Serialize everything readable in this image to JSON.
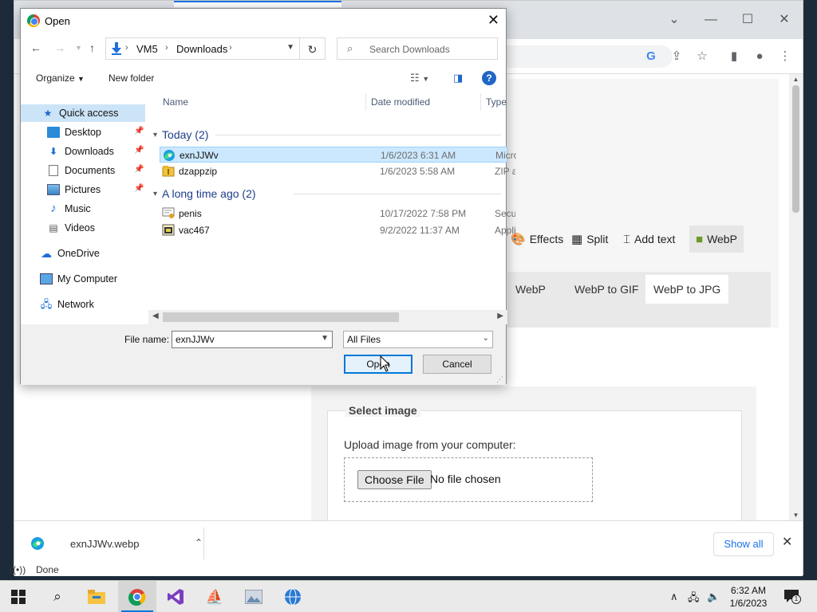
{
  "browser": {
    "tools": [
      "Effects",
      "Split",
      "Add text",
      "WebP"
    ],
    "tabs": [
      "WebP",
      "WebP to GIF",
      "WebP to JPG"
    ],
    "select_image": {
      "legend": "Select image",
      "upload_label": "Upload image from your computer:",
      "choose_button": "Choose File",
      "no_file": "No file chosen"
    },
    "downloads": {
      "file": "exnJJWv.webp",
      "show_all": "Show all"
    },
    "status": "Done"
  },
  "dialog": {
    "title": "Open",
    "path": [
      "VM5",
      "Downloads"
    ],
    "search_placeholder": "Search Downloads",
    "organize": "Organize",
    "new_folder": "New folder",
    "nav": [
      {
        "label": "Quick access",
        "icon": "star-icon",
        "pinned": false
      },
      {
        "label": "Desktop",
        "icon": "desktop-icon",
        "pinned": true
      },
      {
        "label": "Downloads",
        "icon": "download-icon",
        "pinned": true
      },
      {
        "label": "Documents",
        "icon": "document-icon",
        "pinned": true
      },
      {
        "label": "Pictures",
        "icon": "pictures-icon",
        "pinned": true
      },
      {
        "label": "Music",
        "icon": "music-icon",
        "pinned": false
      },
      {
        "label": "Videos",
        "icon": "video-icon",
        "pinned": false
      },
      {
        "label": "OneDrive",
        "icon": "cloud-icon",
        "pinned": false
      },
      {
        "label": "My Computer",
        "icon": "computer-icon",
        "pinned": false
      },
      {
        "label": "Network",
        "icon": "network-icon",
        "pinned": false
      }
    ],
    "columns": {
      "name": "Name",
      "date": "Date modified",
      "type": "Type"
    },
    "groups": [
      {
        "label": "Today (2)",
        "files": [
          {
            "name": "exnJJWv",
            "date": "1/6/2023 6:31 AM",
            "type": "Micro",
            "icon": "edge-icon",
            "selected": true
          },
          {
            "name": "dzappzip",
            "date": "1/6/2023 5:58 AM",
            "type": "ZIP a",
            "icon": "zip-icon",
            "selected": false
          }
        ]
      },
      {
        "label": "A long time ago (2)",
        "files": [
          {
            "name": "penis",
            "date": "10/17/2022 7:58 PM",
            "type": "Secu",
            "icon": "certificate-icon",
            "selected": false
          },
          {
            "name": "vac467",
            "date": "9/2/2022 11:37 AM",
            "type": "Appli",
            "icon": "application-icon",
            "selected": false
          }
        ]
      }
    ],
    "file_name_label": "File name:",
    "file_name_value": "exnJJWv",
    "filter": "All Files",
    "open_button": "Open",
    "cancel_button": "Cancel"
  },
  "taskbar": {
    "time": "6:32 AM",
    "date": "1/6/2023",
    "notification_count": "1"
  }
}
